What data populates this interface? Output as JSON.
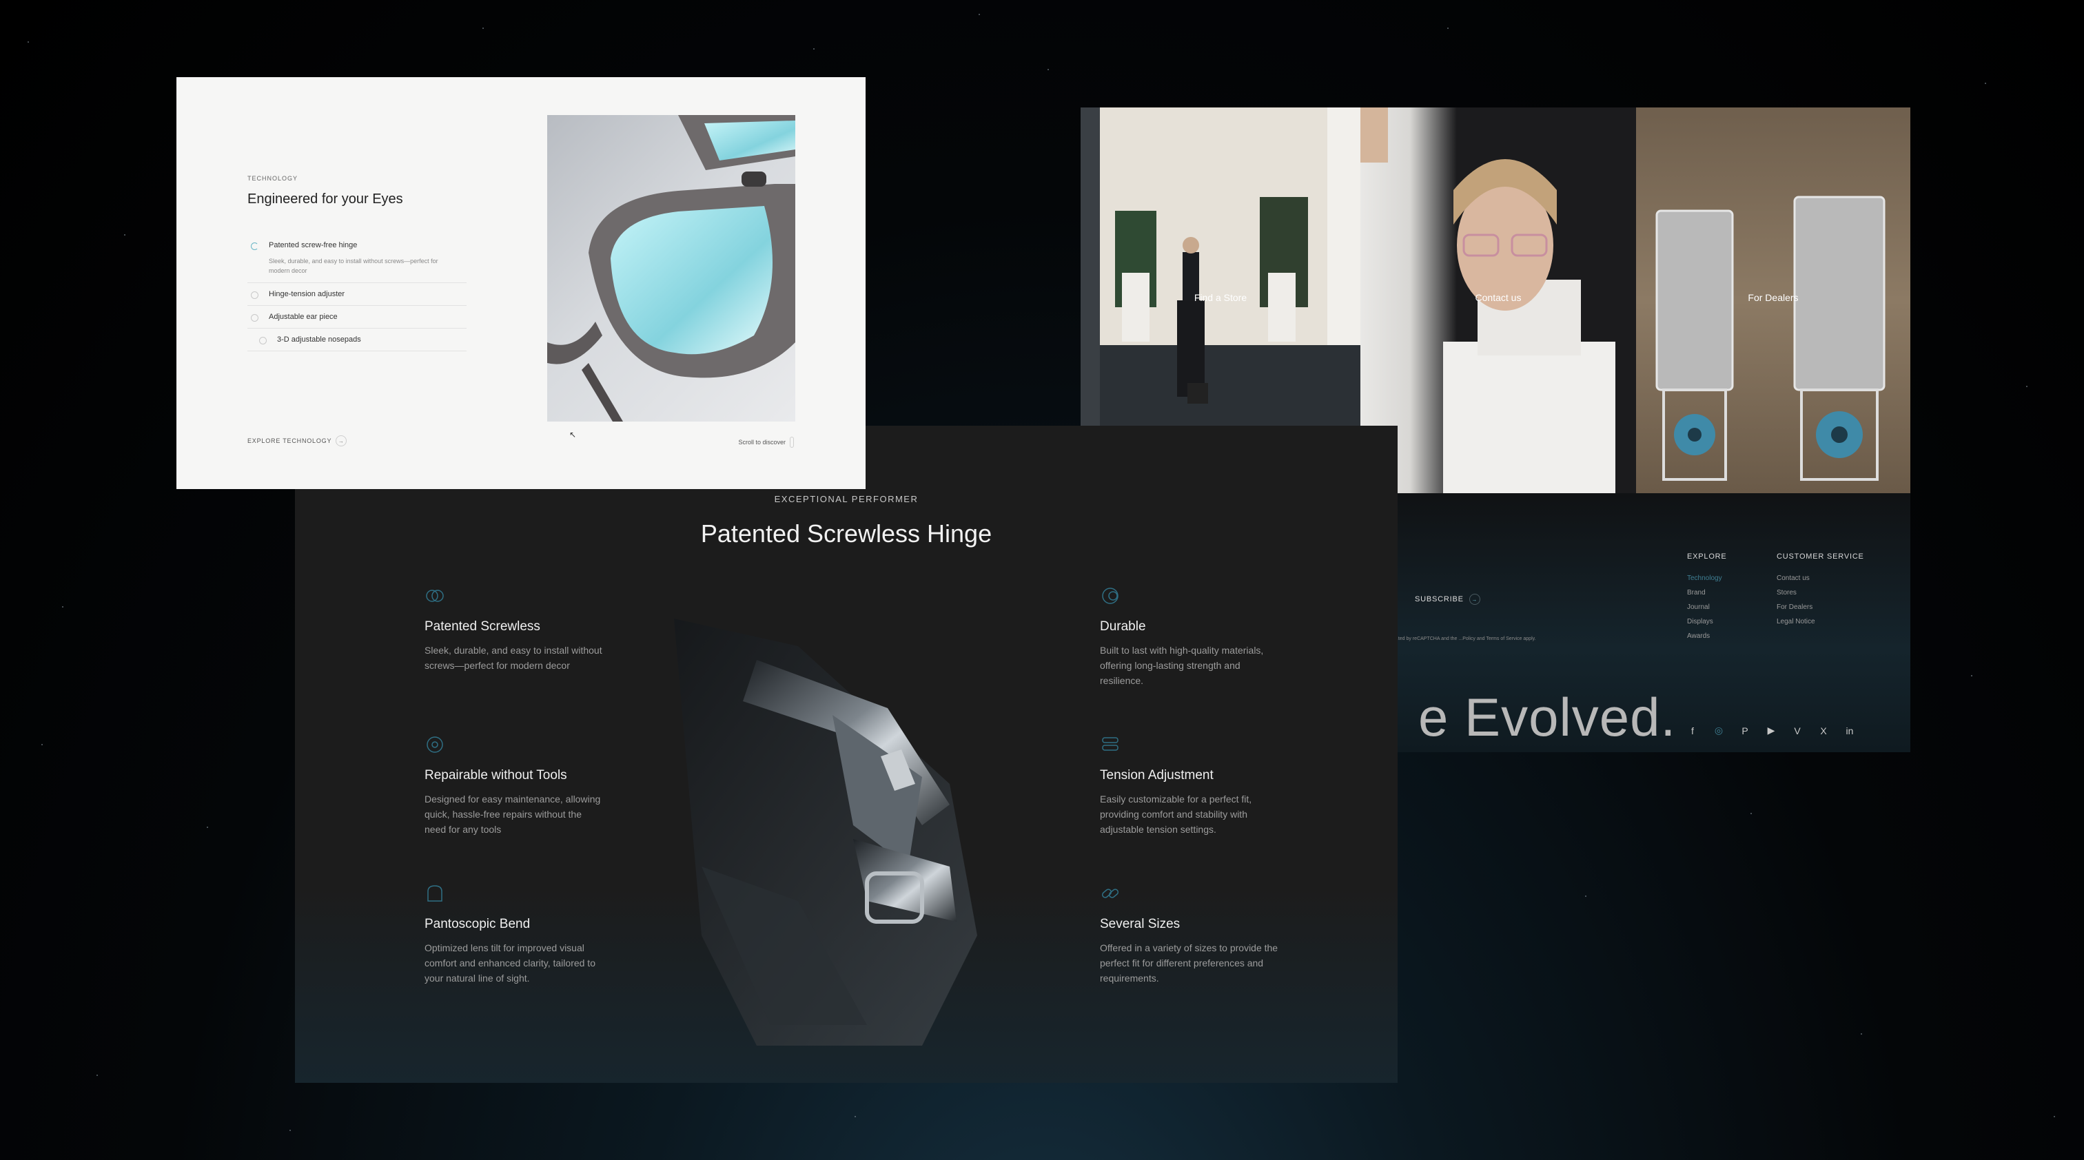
{
  "tech_panel": {
    "eyebrow": "TECHNOLOGY",
    "heading": "Engineered for your Eyes",
    "features": [
      {
        "label": "Patented screw-free hinge",
        "desc": "Sleek, durable, and easy to install without screws—perfect for modern decor"
      },
      {
        "label": "Hinge-tension adjuster"
      },
      {
        "label": "Adjustable ear piece"
      },
      {
        "label": "3-D adjustable nosepads"
      }
    ],
    "explore_label": "EXPLORE TECHNOLOGY",
    "scroll_label": "Scroll to discover"
  },
  "hinge_panel": {
    "eyebrow": "EXCEPTIONAL PERFORMER",
    "heading": "Patented Screwless Hinge",
    "features": [
      {
        "title": "Patented Screwless",
        "desc": "Sleek, durable, and easy to install without screws—perfect for modern decor",
        "icon": "rings-icon"
      },
      {
        "title": "Repairable without Tools",
        "desc": "Designed for easy maintenance, allowing quick, hassle-free repairs without the need for any tools",
        "icon": "wrench-circle-icon"
      },
      {
        "title": "Pantoscopic Bend",
        "desc": "Optimized lens tilt for improved visual comfort and enhanced clarity, tailored to your natural line of sight.",
        "icon": "bend-icon"
      },
      {
        "title": "Durable",
        "desc": "Built to last with high-quality materials, offering long-lasting strength and resilience.",
        "icon": "shield-rings-icon"
      },
      {
        "title": "Tension Adjustment",
        "desc": "Easily customizable for a perfect fit, providing comfort and stability with adjustable tension settings.",
        "icon": "layers-icon"
      },
      {
        "title": "Several Sizes",
        "desc": "Offered in a variety of sizes to provide the perfect fit for different preferences and requirements.",
        "icon": "link-icon"
      }
    ]
  },
  "links_panel": {
    "cells": [
      "Find a Store",
      "Contact us",
      "For Dealers"
    ]
  },
  "footer_panel": {
    "subscribe_label": "SUBSCRIBE",
    "recaptcha_text": "...ted by reCAPTCHA and the ...Policy and Terms of Service apply.",
    "tagline": "e Evolved.",
    "explore": {
      "title": "EXPLORE",
      "links": [
        "Technology",
        "Brand",
        "Journal",
        "Displays",
        "Awards"
      ]
    },
    "customer_service": {
      "title": "CUSTOMER SERVICE",
      "links": [
        "Contact us",
        "Stores",
        "For Dealers",
        "Legal Notice"
      ]
    },
    "social": [
      "f",
      "◎",
      "P",
      "▶",
      "V",
      "X",
      "in"
    ]
  },
  "colors": {
    "accent": "#3f7f93",
    "dark_panel": "#1c1c1c",
    "light_panel": "#f6f6f5"
  }
}
